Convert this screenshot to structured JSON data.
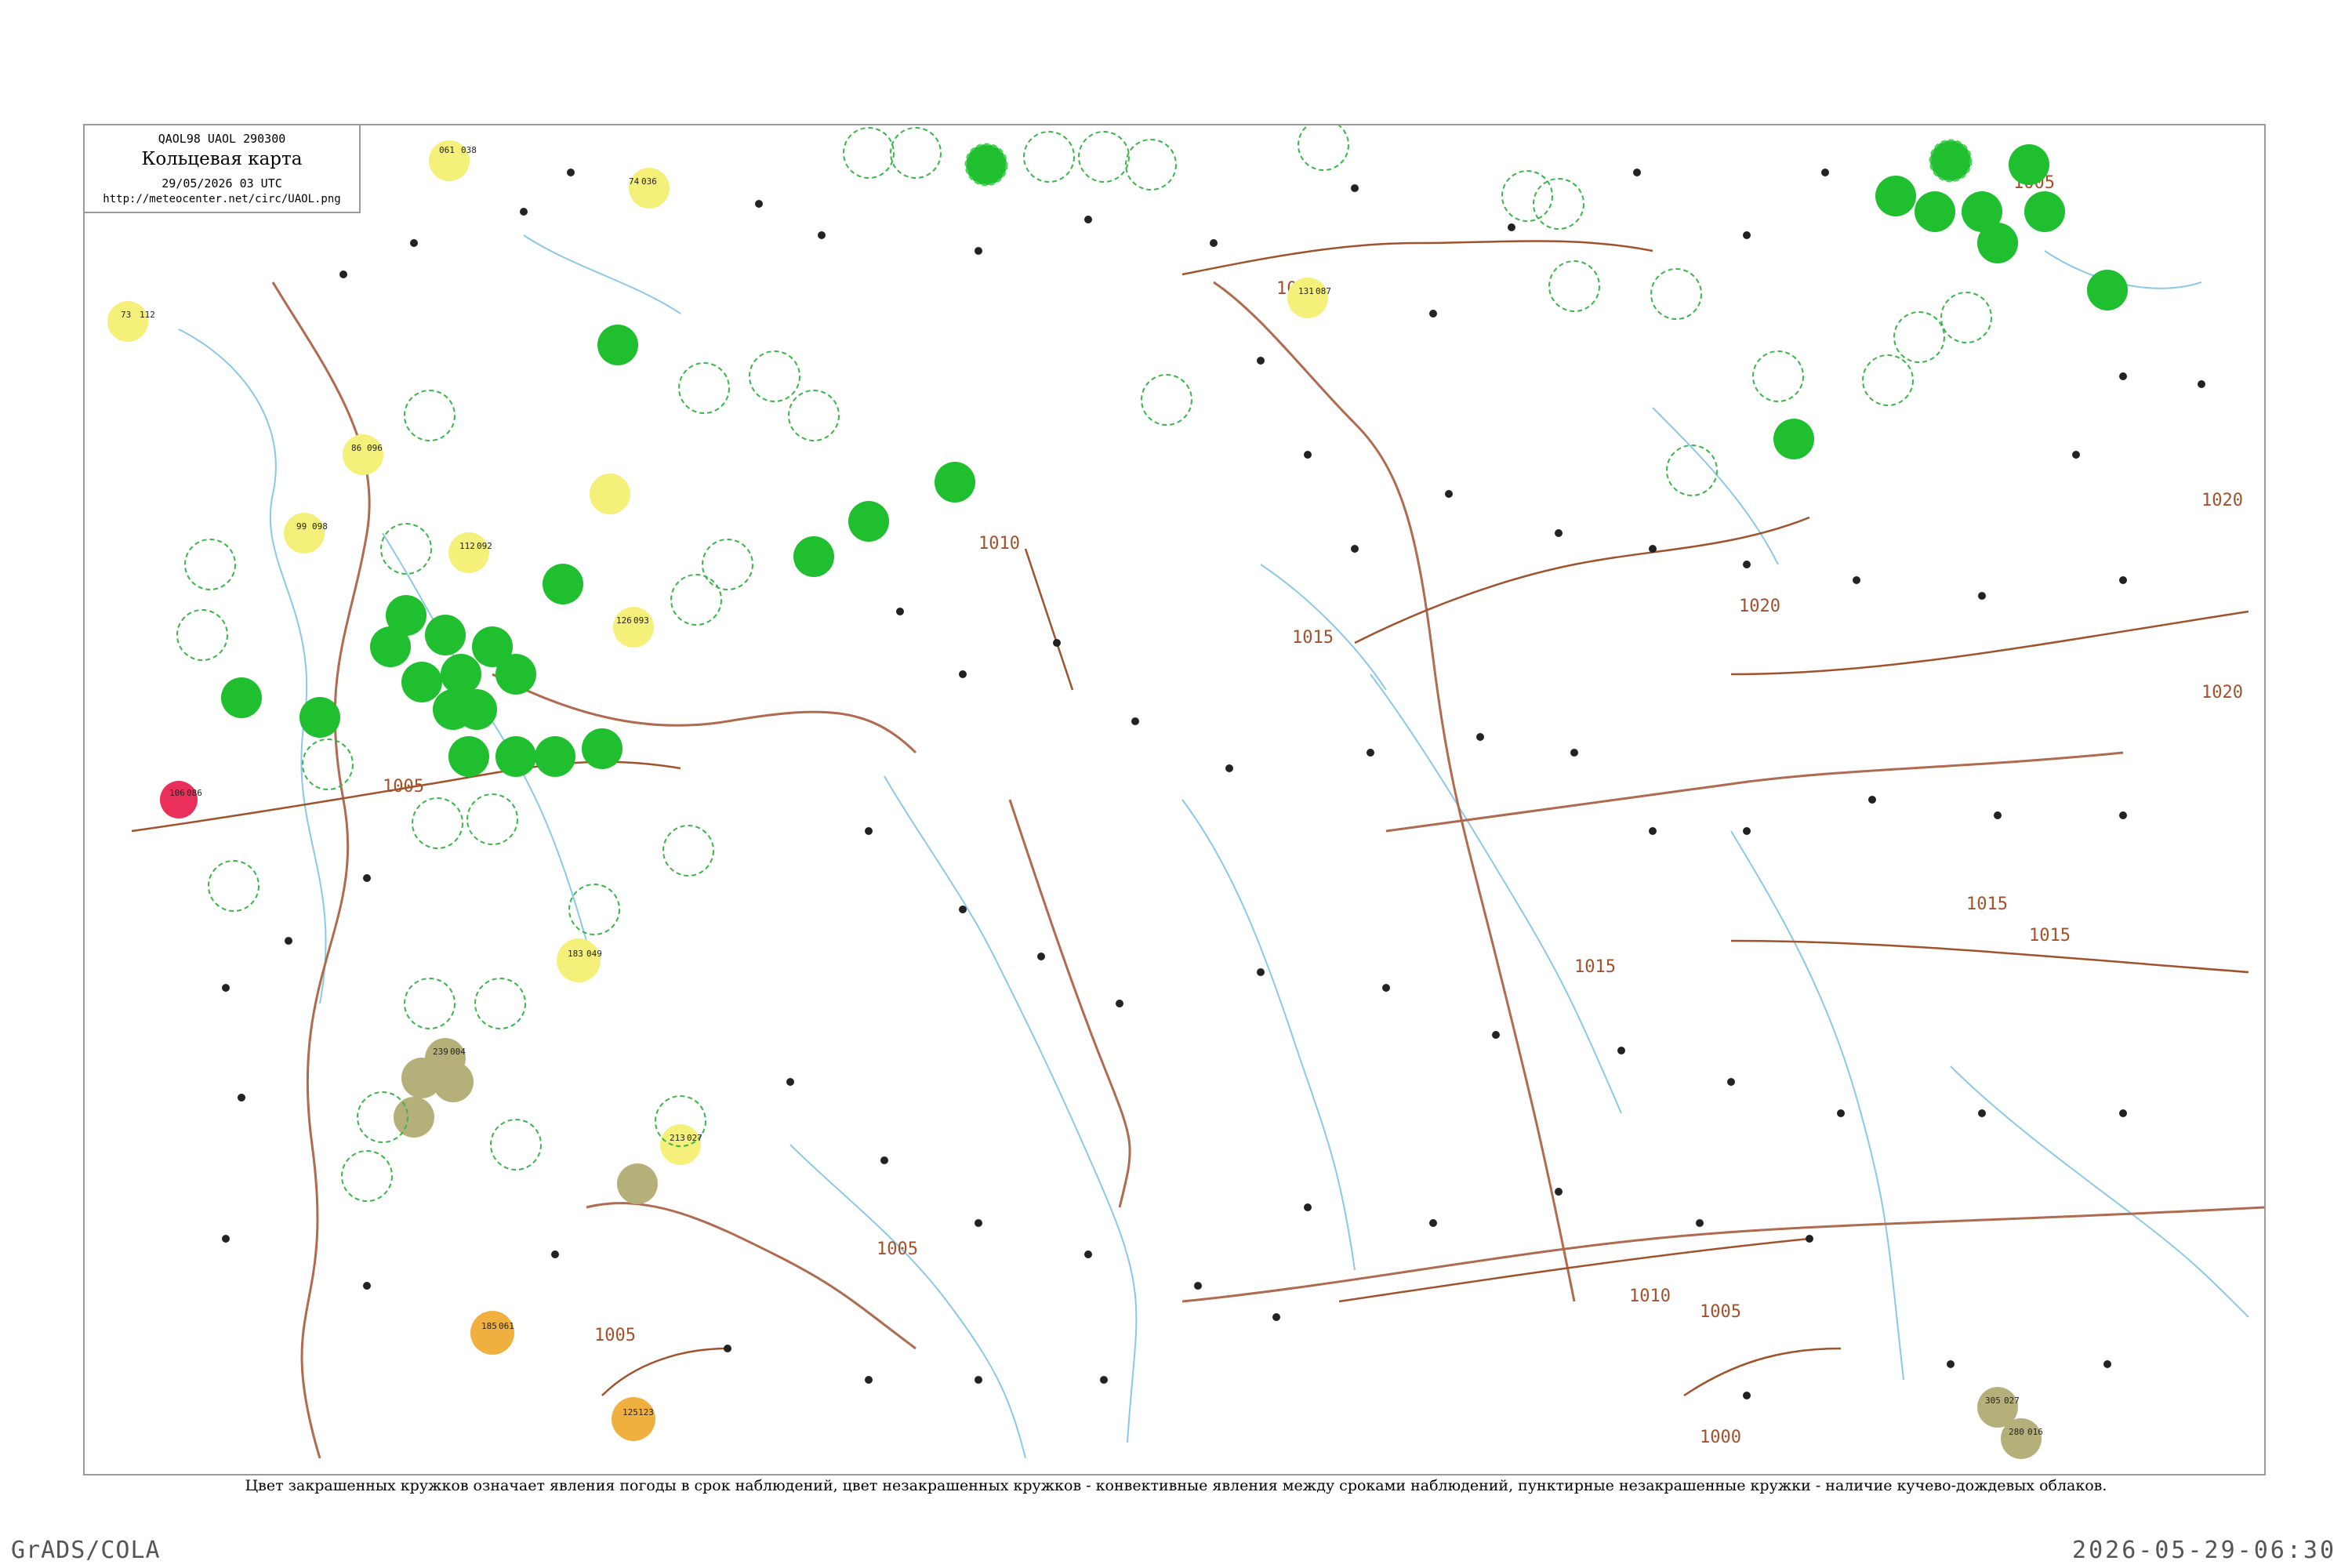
{
  "title_box": {
    "code": "QAOL98  UAOL  290300",
    "name": "Кольцевая карта",
    "datetime": "29/05/2026 03 UTC",
    "url": "http://meteocenter.net/circ/UAOL.png"
  },
  "caption": "Цвет закрашенных кружков означает явления погоды в срок наблюдений, цвет незакрашенных кружков - конвективные явления между сроками наблюдений, пунктирные незакрашенные кружки - наличие кучево-дождевых облаков.",
  "footer": {
    "left": "GrADS/COLA",
    "right": "2026-05-29-06:30"
  },
  "colors": {
    "frame": "#9a9a9a",
    "isobar": "#a0522d",
    "border": "#b06a50",
    "rivers": "#8cc8e6",
    "precip_green": "#1fbf2f",
    "fog_yellow": "#f5f07a",
    "haze_tan": "#b5b07a",
    "orange": "#f0b040",
    "storm_red": "#e8305a",
    "cb_outline": "#3cb44b"
  },
  "isobar_labels": [
    "1005",
    "1010",
    "1015",
    "1020",
    "1000"
  ],
  "legend_symbols": {
    "filled_green": "precipitation-at-observation",
    "filled_yellow": "fog-mist-at-observation",
    "filled_tan": "haze-dust-at-observation",
    "filled_orange": "dust-storm",
    "filled_red": "thunderstorm",
    "dashed_green_ring": "cumulonimbus-present",
    "solid_green_ring": "convective-phenomena-between-obs"
  },
  "stations": [
    {
      "p": "061",
      "t": "038",
      "c": "yellow"
    },
    {
      "p": "036",
      "t": "74",
      "c": "yellow"
    },
    {
      "p": "112",
      "t": "73",
      "c": "yellow"
    },
    {
      "p": "096",
      "t": "86",
      "c": "yellow"
    },
    {
      "p": "098",
      "t": "99",
      "c": "yellow"
    },
    {
      "p": "092",
      "t": "112",
      "c": "yellow"
    },
    {
      "p": "093",
      "t": "126",
      "c": "yellow"
    },
    {
      "p": "086",
      "t": "106",
      "c": "red"
    },
    {
      "p": "087",
      "t": "131",
      "c": "yellow"
    },
    {
      "p": "049",
      "t": "183",
      "c": "yellow"
    },
    {
      "p": "027",
      "t": "213",
      "c": "yellow"
    },
    {
      "p": "061",
      "t": "185",
      "c": "orange"
    },
    {
      "p": "123",
      "t": "125",
      "c": "orange"
    },
    {
      "p": "004",
      "t": "239",
      "c": "tan"
    },
    {
      "p": "016",
      "t": "280",
      "c": "tan"
    },
    {
      "p": "027",
      "t": "305",
      "c": "tan"
    }
  ]
}
